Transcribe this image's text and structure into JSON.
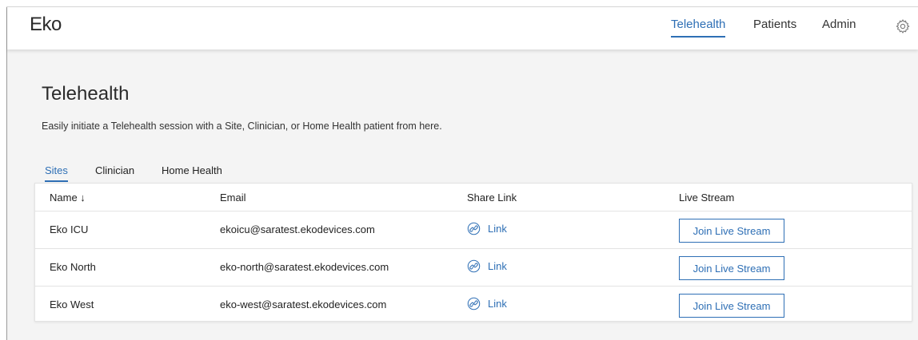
{
  "app": {
    "logo": "Eko"
  },
  "nav": {
    "items": [
      "Telehealth",
      "Patients",
      "Admin"
    ],
    "active": "Telehealth"
  },
  "page": {
    "title": "Telehealth",
    "subtitle": "Easily initiate a Telehealth session with a Site, Clinician, or Home Health patient from here."
  },
  "tabs": [
    "Sites",
    "Clinician",
    "Home Health"
  ],
  "table": {
    "headers": [
      "Name ↓",
      "Email",
      "Share Link",
      "Live Stream"
    ],
    "rows": [
      {
        "name": "Eko ICU",
        "email": "ekoicu@saratest.ekodevices.com",
        "link": "Link",
        "action": "Join Live Stream"
      },
      {
        "name": "Eko North",
        "email": "eko-north@saratest.ekodevices.com",
        "link": "Link",
        "action": "Join Live Stream"
      },
      {
        "name": "Eko West",
        "email": "eko-west@saratest.ekodevices.com",
        "link": "Link",
        "action": "Join Live Stream"
      }
    ]
  },
  "colors": {
    "accent": "#2e6fb5",
    "background": "#f4f4f4",
    "text": "#222222"
  },
  "icons": {
    "settings": "gear-icon",
    "share": "link-icon",
    "sort": "arrow-down-icon"
  }
}
